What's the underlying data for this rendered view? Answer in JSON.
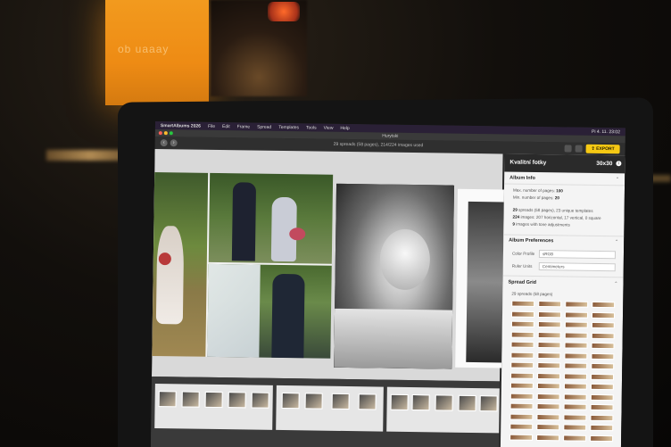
{
  "background": {
    "sign_text": "ob uaaay"
  },
  "menubar": {
    "app_name": "SmartAlbums 2026",
    "items": [
      "File",
      "Edit",
      "Frame",
      "Spread",
      "Templates",
      "Tools",
      "View",
      "Help"
    ],
    "clock": "Pi 4. 11. 23:02"
  },
  "window": {
    "title": "Hurytski"
  },
  "toolbar": {
    "info": "29 spreads (58 pages), 214/224 images used",
    "export_label": "EXPORT"
  },
  "panel": {
    "title": "Kvalitní fotky",
    "size": "30x30",
    "album_info": {
      "heading": "Album Info",
      "max_pages_label": "Max. number of pages:",
      "max_pages_value": "100",
      "min_pages_label": "Min. number of pages:",
      "min_pages_value": "20",
      "spreads_line_count": "29",
      "spreads_line": "spreads (58 pages), 23 unique templates",
      "images_line_count": "224",
      "images_line": "images: 207 horizontal, 17 vertical, 0 square",
      "adjust_line_count": "9",
      "adjust_line": "images with tone adjustments"
    },
    "album_preferences": {
      "heading": "Album Preferences",
      "color_profile_label": "Color Profile",
      "color_profile_value": "sRGB",
      "ruler_units_label": "Ruler Units",
      "ruler_units_value": "Centimeters"
    },
    "spread_grid": {
      "heading": "Spread Grid",
      "summary": "29 spreads (58 pages)"
    }
  }
}
